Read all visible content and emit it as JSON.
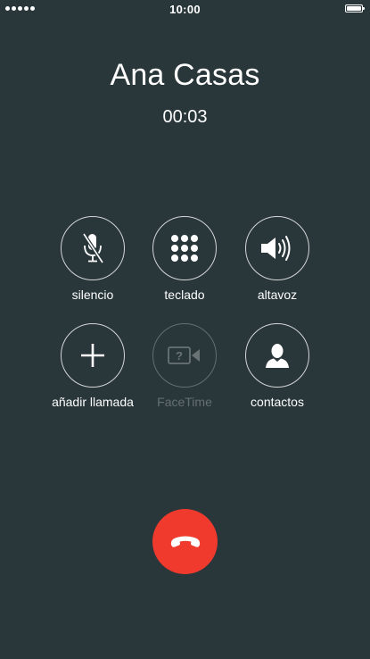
{
  "status_bar": {
    "time": "10:00"
  },
  "call": {
    "caller_name": "Ana Casas",
    "duration": "00:03"
  },
  "controls": {
    "mute": {
      "label": "silencio",
      "icon": "microphone-muted-icon"
    },
    "keypad": {
      "label": "teclado",
      "icon": "keypad-icon"
    },
    "speaker": {
      "label": "altavoz",
      "icon": "speaker-icon"
    },
    "add_call": {
      "label": "añadir llamada",
      "icon": "plus-icon"
    },
    "facetime": {
      "label": "FaceTime",
      "icon": "facetime-icon",
      "enabled": false
    },
    "contacts": {
      "label": "contactos",
      "icon": "contact-icon"
    }
  },
  "end_call": {
    "icon": "hang-up-icon"
  },
  "colors": {
    "background": "#29363a",
    "end_call": "#f03a2e",
    "foreground": "#ffffff"
  }
}
